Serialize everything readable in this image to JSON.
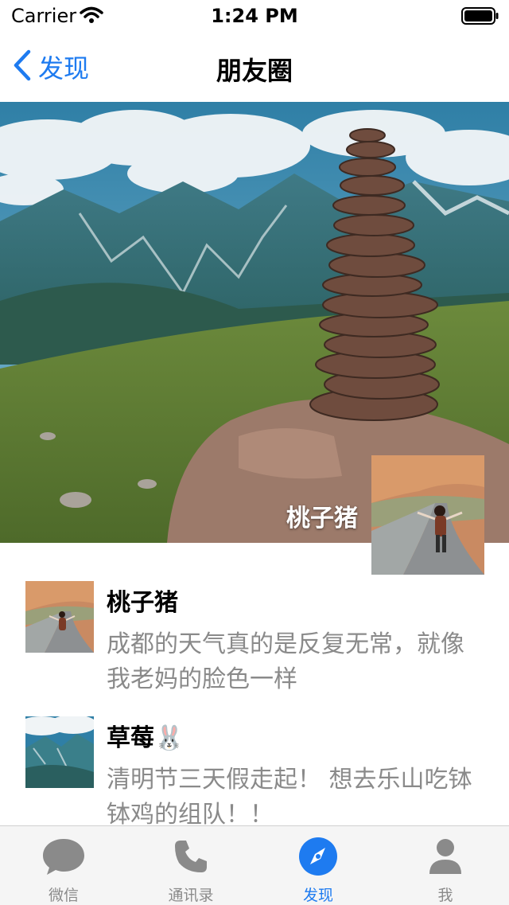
{
  "status_bar": {
    "carrier": "Carrier",
    "time": "1:24 PM"
  },
  "nav": {
    "back_label": "发现",
    "title": "朋友圈"
  },
  "cover": {
    "user_name": "桃子猪"
  },
  "posts": [
    {
      "author": "桃子猪",
      "text": "成都的天气真的是反复无常，就像我老妈的脸色一样"
    },
    {
      "author": "草莓🐰",
      "text": "清明节三天假走起！ 想去乐山吃钵钵鸡的组队！！"
    }
  ],
  "tabs": [
    {
      "label": "微信",
      "icon": "chat-bubble-icon",
      "active": false
    },
    {
      "label": "通讯录",
      "icon": "phone-icon",
      "active": false
    },
    {
      "label": "发现",
      "icon": "compass-icon",
      "active": true
    },
    {
      "label": "我",
      "icon": "person-icon",
      "active": false
    }
  ],
  "colors": {
    "accent": "#1e7bf0",
    "inactive": "#8a8a8a",
    "post_text": "#8a8a8a"
  }
}
